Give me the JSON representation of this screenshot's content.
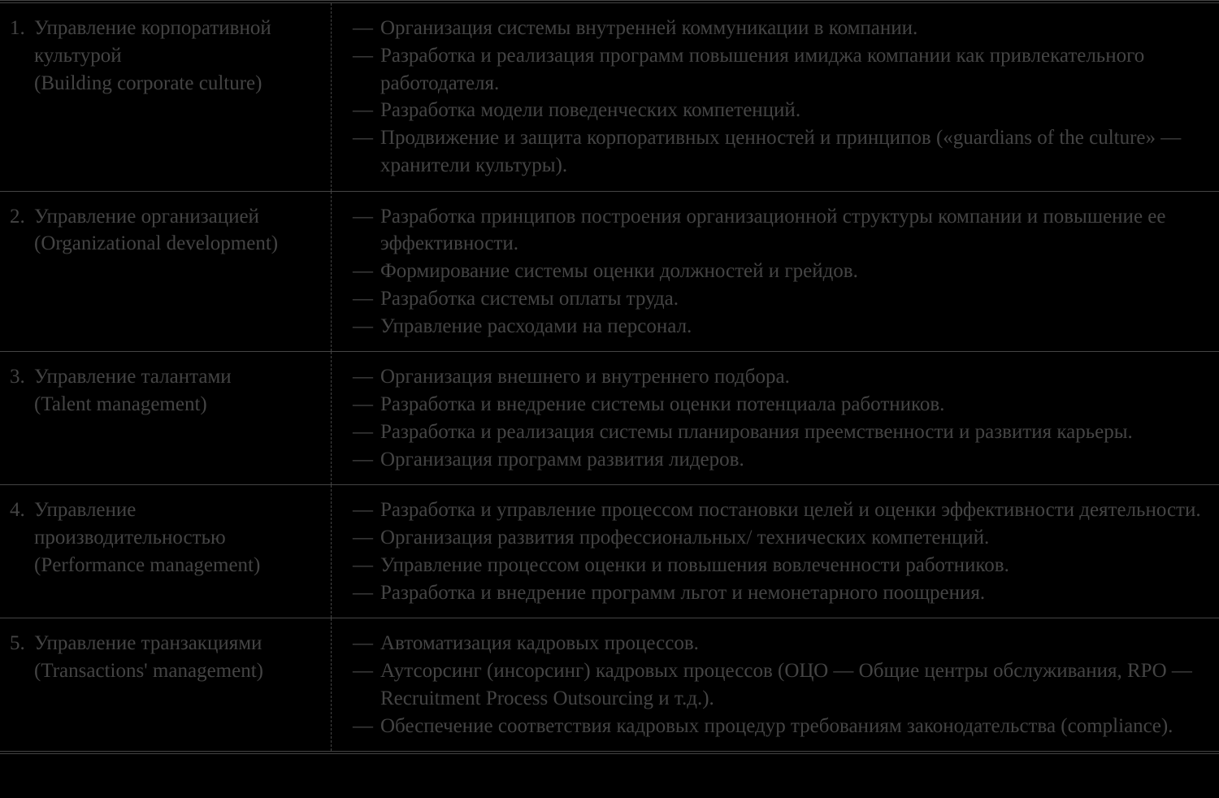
{
  "rows": [
    {
      "num": "1.",
      "title": "Управление корпоративной культурой\n(Building corporate culture)",
      "bullets": [
        "Организация системы внутренней коммуникации в компании.",
        "Разработка и реализация программ повышения имиджа компании как привлекательного работодателя.",
        "Разработка модели поведенческих компетенций.",
        "Продвижение и защита корпоративных ценностей и принципов («guardians of the culture» — хранители культуры)."
      ]
    },
    {
      "num": "2.",
      "title": "Управление организацией\n(Organizational development)",
      "bullets": [
        "Разработка принципов построения организационной структуры компании и повышение ее эффективности.",
        "Формирование системы оценки должностей и грейдов.",
        "Разработка системы оплаты труда.",
        "Управление расходами на персонал."
      ]
    },
    {
      "num": "3.",
      "title": "Управление талантами\n(Talent management)",
      "bullets": [
        "Организация внешнего и внутреннего подбора.",
        "Разработка и внедрение системы оценки потенциала работников.",
        "Разработка и реализация системы планирования преемственности и развития карьеры.",
        "Организация программ развития лидеров."
      ]
    },
    {
      "num": "4.",
      "title": "Управление производительностью\n(Performance management)",
      "bullets": [
        "Разработка и управление процессом постановки целей и оценки эффективности деятельности.",
        "Организация развития профессиональных/ технических компетенций.",
        "Управление процессом оценки и повышения вовлеченности работников.",
        "Разработка и внедрение программ льгот и немонетарного поощрения."
      ]
    },
    {
      "num": "5.",
      "title": "Управление транзакциями\n(Transactions' management)",
      "bullets": [
        "Автоматизация кадровых процессов.",
        "Аутсорсинг (инсорсинг) кадровых процессов (ОЦО — Общие центры обслуживания, RPO — Recruitment Process Outsourcing и т.д.).",
        "Обеспечение соответствия кадровых процедур требованиям законодательства (compliance)."
      ]
    }
  ]
}
